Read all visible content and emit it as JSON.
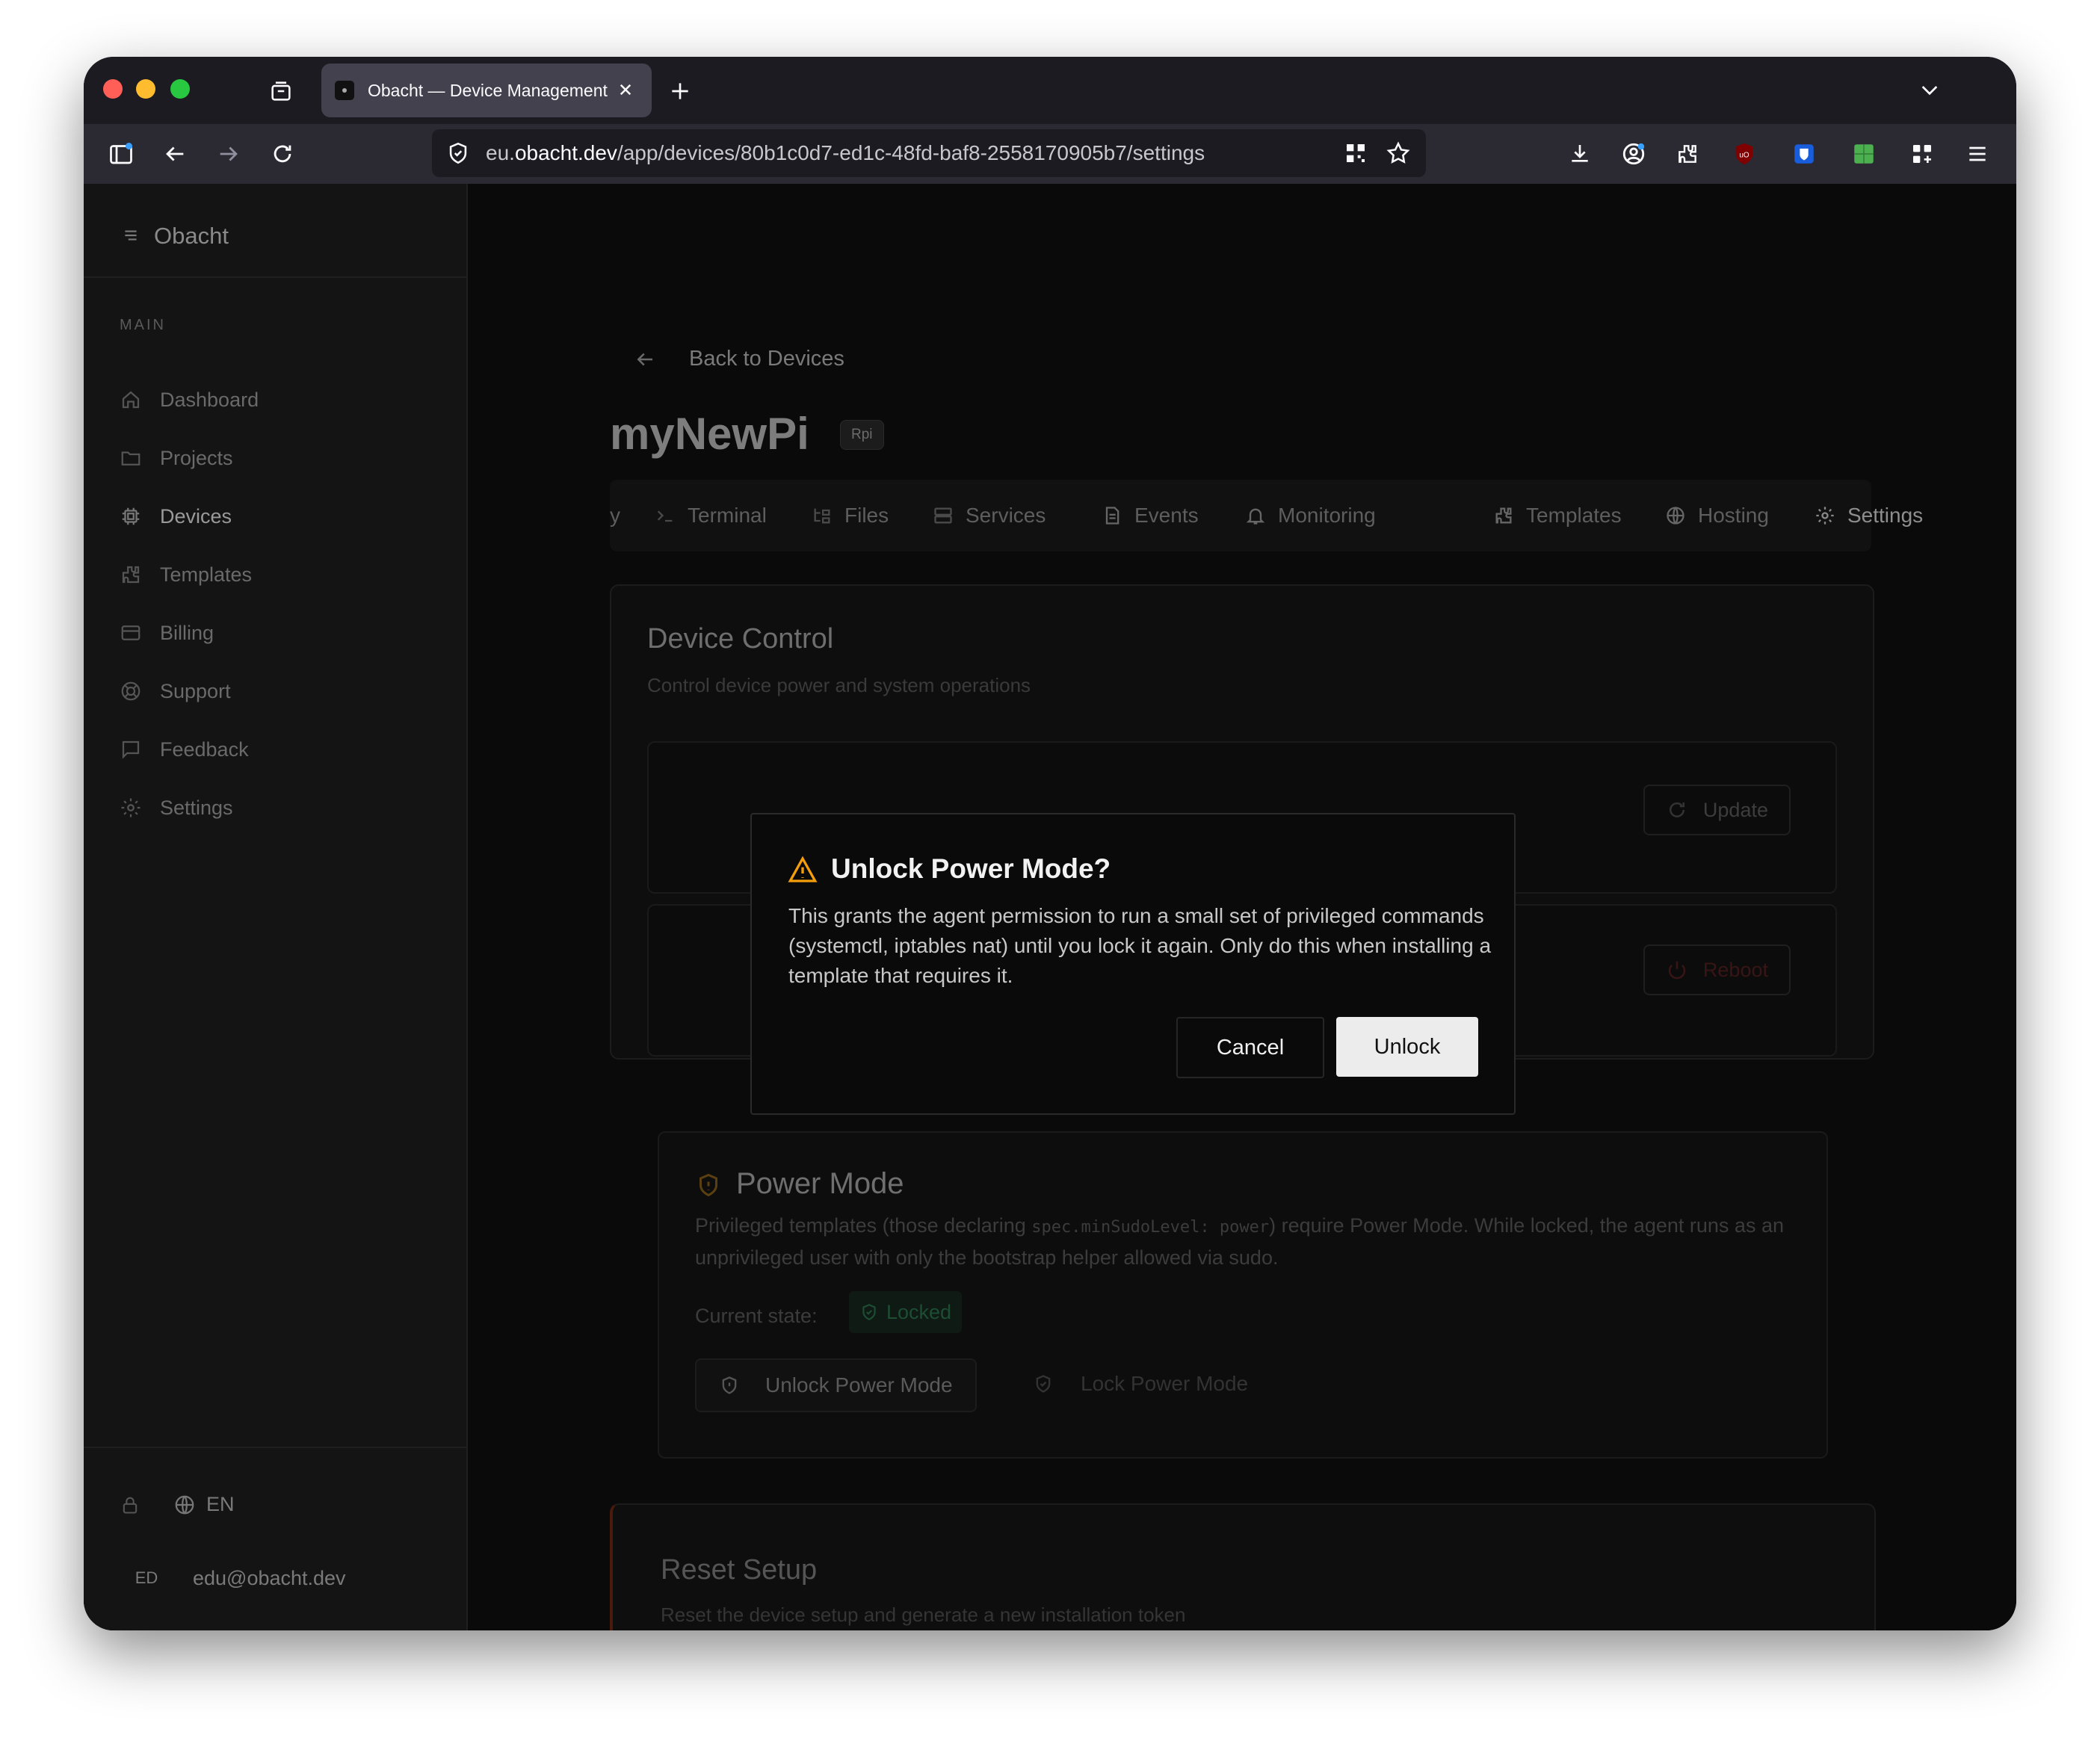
{
  "browser": {
    "tab_title": "Obacht — Device Management",
    "url_prefix": "eu.",
    "url_domain": "obacht.dev",
    "url_path": "/app/devices/80b1c0d7-ed1c-48fd-baf8-2558170905b7/settings"
  },
  "sidebar": {
    "brand": "Obacht",
    "section": "MAIN",
    "items": [
      {
        "label": "Dashboard",
        "icon": "home-icon"
      },
      {
        "label": "Projects",
        "icon": "folder-icon"
      },
      {
        "label": "Devices",
        "icon": "chip-icon"
      },
      {
        "label": "Templates",
        "icon": "puzzle-icon"
      },
      {
        "label": "Billing",
        "icon": "card-icon"
      },
      {
        "label": "Support",
        "icon": "lifebuoy-icon"
      },
      {
        "label": "Feedback",
        "icon": "chat-icon"
      },
      {
        "label": "Settings",
        "icon": "gear-icon"
      }
    ],
    "language": "EN",
    "user_initials": "ED",
    "user_email": "edu@obacht.dev"
  },
  "page": {
    "back_label": "Back to Devices",
    "device_name": "myNewPi",
    "device_badge": "Rpi",
    "tabs": [
      {
        "label": "y"
      },
      {
        "label": "Terminal"
      },
      {
        "label": "Files"
      },
      {
        "label": "Services"
      },
      {
        "label": "Events"
      },
      {
        "label": "Monitoring"
      },
      {
        "label": "Templates"
      },
      {
        "label": "Hosting"
      },
      {
        "label": "Settings"
      }
    ],
    "device_control": {
      "title": "Device Control",
      "subtitle": "Control device power and system operations",
      "update_label": "Update",
      "reboot_label": "Reboot"
    },
    "power_mode": {
      "title": "Power Mode",
      "text_before": "Privileged templates (those declaring ",
      "code": "spec.minSudoLevel: power",
      "text_after": ") require Power Mode. While locked, the agent runs as an unprivileged user with only the bootstrap helper allowed via sudo.",
      "state_label": "Current state:",
      "state_value": "Locked",
      "unlock_label": "Unlock Power Mode",
      "lock_label": "Lock Power Mode"
    },
    "reset": {
      "title": "Reset Setup",
      "subtitle": "Reset the device setup and generate a new installation token"
    }
  },
  "dialog": {
    "title": "Unlock Power Mode?",
    "body": "This grants the agent permission to run a small set of privileged commands (systemctl, iptables nat) until you lock it again. Only do this when installing a template that requires it.",
    "cancel_label": "Cancel",
    "confirm_label": "Unlock",
    "warning_color": "#f59e0b"
  }
}
